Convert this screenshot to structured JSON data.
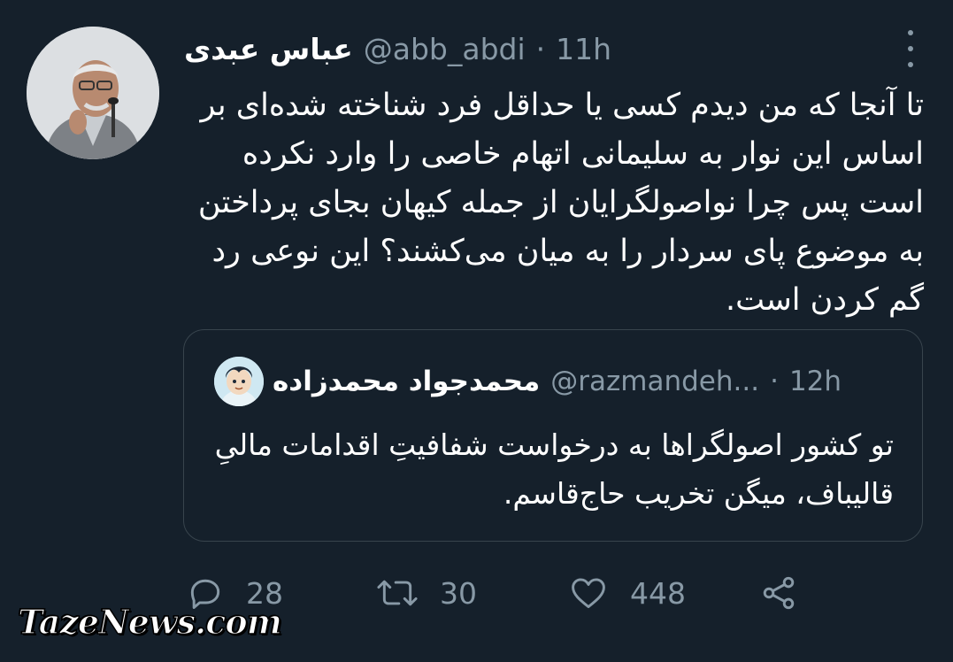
{
  "tweet": {
    "author_name": "عباس عبدی",
    "handle": "@abb_abdi",
    "separator": "·",
    "time": "11h",
    "text": "تا آنجا که من دیدم کسی یا حداقل فرد شناخته شده‌ای بر اساس این نوار به سلیمانی اتهام خاصی را وارد نکرده است پس چرا نواصولگرایان از جمله کیهان بجای پرداختن به موضوع پای سردار را به میان می‌کشند؟ این نوعی رد گم کردن است.",
    "more_icon": "more-vertical-icon"
  },
  "quoted": {
    "author_name": "محمدجواد محمدزاده",
    "handle": "@razmandeh...",
    "separator": "·",
    "time": "12h",
    "text": "تو کشور اصولگراها به درخواست شفافیتِ اقدامات مالیِ قالیباف، میگن تخریب حاج‌قاسم."
  },
  "actions": {
    "reply": {
      "icon": "reply-icon",
      "count": "28"
    },
    "retweet": {
      "icon": "retweet-icon",
      "count": "30"
    },
    "like": {
      "icon": "heart-icon",
      "count": "448"
    },
    "share": {
      "icon": "share-icon"
    }
  },
  "watermark": "TazeNews.com",
  "colors": {
    "background": "#15202b",
    "text": "#ffffff",
    "muted": "#8899a6",
    "border": "#38444d"
  }
}
